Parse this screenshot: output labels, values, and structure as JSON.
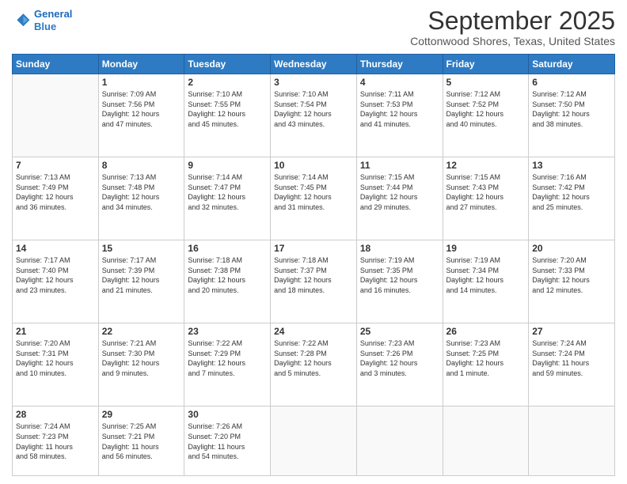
{
  "logo": {
    "line1": "General",
    "line2": "Blue"
  },
  "title": "September 2025",
  "location": "Cottonwood Shores, Texas, United States",
  "days_of_week": [
    "Sunday",
    "Monday",
    "Tuesday",
    "Wednesday",
    "Thursday",
    "Friday",
    "Saturday"
  ],
  "weeks": [
    [
      {
        "num": "",
        "info": ""
      },
      {
        "num": "1",
        "info": "Sunrise: 7:09 AM\nSunset: 7:56 PM\nDaylight: 12 hours\nand 47 minutes."
      },
      {
        "num": "2",
        "info": "Sunrise: 7:10 AM\nSunset: 7:55 PM\nDaylight: 12 hours\nand 45 minutes."
      },
      {
        "num": "3",
        "info": "Sunrise: 7:10 AM\nSunset: 7:54 PM\nDaylight: 12 hours\nand 43 minutes."
      },
      {
        "num": "4",
        "info": "Sunrise: 7:11 AM\nSunset: 7:53 PM\nDaylight: 12 hours\nand 41 minutes."
      },
      {
        "num": "5",
        "info": "Sunrise: 7:12 AM\nSunset: 7:52 PM\nDaylight: 12 hours\nand 40 minutes."
      },
      {
        "num": "6",
        "info": "Sunrise: 7:12 AM\nSunset: 7:50 PM\nDaylight: 12 hours\nand 38 minutes."
      }
    ],
    [
      {
        "num": "7",
        "info": "Sunrise: 7:13 AM\nSunset: 7:49 PM\nDaylight: 12 hours\nand 36 minutes."
      },
      {
        "num": "8",
        "info": "Sunrise: 7:13 AM\nSunset: 7:48 PM\nDaylight: 12 hours\nand 34 minutes."
      },
      {
        "num": "9",
        "info": "Sunrise: 7:14 AM\nSunset: 7:47 PM\nDaylight: 12 hours\nand 32 minutes."
      },
      {
        "num": "10",
        "info": "Sunrise: 7:14 AM\nSunset: 7:45 PM\nDaylight: 12 hours\nand 31 minutes."
      },
      {
        "num": "11",
        "info": "Sunrise: 7:15 AM\nSunset: 7:44 PM\nDaylight: 12 hours\nand 29 minutes."
      },
      {
        "num": "12",
        "info": "Sunrise: 7:15 AM\nSunset: 7:43 PM\nDaylight: 12 hours\nand 27 minutes."
      },
      {
        "num": "13",
        "info": "Sunrise: 7:16 AM\nSunset: 7:42 PM\nDaylight: 12 hours\nand 25 minutes."
      }
    ],
    [
      {
        "num": "14",
        "info": "Sunrise: 7:17 AM\nSunset: 7:40 PM\nDaylight: 12 hours\nand 23 minutes."
      },
      {
        "num": "15",
        "info": "Sunrise: 7:17 AM\nSunset: 7:39 PM\nDaylight: 12 hours\nand 21 minutes."
      },
      {
        "num": "16",
        "info": "Sunrise: 7:18 AM\nSunset: 7:38 PM\nDaylight: 12 hours\nand 20 minutes."
      },
      {
        "num": "17",
        "info": "Sunrise: 7:18 AM\nSunset: 7:37 PM\nDaylight: 12 hours\nand 18 minutes."
      },
      {
        "num": "18",
        "info": "Sunrise: 7:19 AM\nSunset: 7:35 PM\nDaylight: 12 hours\nand 16 minutes."
      },
      {
        "num": "19",
        "info": "Sunrise: 7:19 AM\nSunset: 7:34 PM\nDaylight: 12 hours\nand 14 minutes."
      },
      {
        "num": "20",
        "info": "Sunrise: 7:20 AM\nSunset: 7:33 PM\nDaylight: 12 hours\nand 12 minutes."
      }
    ],
    [
      {
        "num": "21",
        "info": "Sunrise: 7:20 AM\nSunset: 7:31 PM\nDaylight: 12 hours\nand 10 minutes."
      },
      {
        "num": "22",
        "info": "Sunrise: 7:21 AM\nSunset: 7:30 PM\nDaylight: 12 hours\nand 9 minutes."
      },
      {
        "num": "23",
        "info": "Sunrise: 7:22 AM\nSunset: 7:29 PM\nDaylight: 12 hours\nand 7 minutes."
      },
      {
        "num": "24",
        "info": "Sunrise: 7:22 AM\nSunset: 7:28 PM\nDaylight: 12 hours\nand 5 minutes."
      },
      {
        "num": "25",
        "info": "Sunrise: 7:23 AM\nSunset: 7:26 PM\nDaylight: 12 hours\nand 3 minutes."
      },
      {
        "num": "26",
        "info": "Sunrise: 7:23 AM\nSunset: 7:25 PM\nDaylight: 12 hours\nand 1 minute."
      },
      {
        "num": "27",
        "info": "Sunrise: 7:24 AM\nSunset: 7:24 PM\nDaylight: 11 hours\nand 59 minutes."
      }
    ],
    [
      {
        "num": "28",
        "info": "Sunrise: 7:24 AM\nSunset: 7:23 PM\nDaylight: 11 hours\nand 58 minutes."
      },
      {
        "num": "29",
        "info": "Sunrise: 7:25 AM\nSunset: 7:21 PM\nDaylight: 11 hours\nand 56 minutes."
      },
      {
        "num": "30",
        "info": "Sunrise: 7:26 AM\nSunset: 7:20 PM\nDaylight: 11 hours\nand 54 minutes."
      },
      {
        "num": "",
        "info": ""
      },
      {
        "num": "",
        "info": ""
      },
      {
        "num": "",
        "info": ""
      },
      {
        "num": "",
        "info": ""
      }
    ]
  ]
}
